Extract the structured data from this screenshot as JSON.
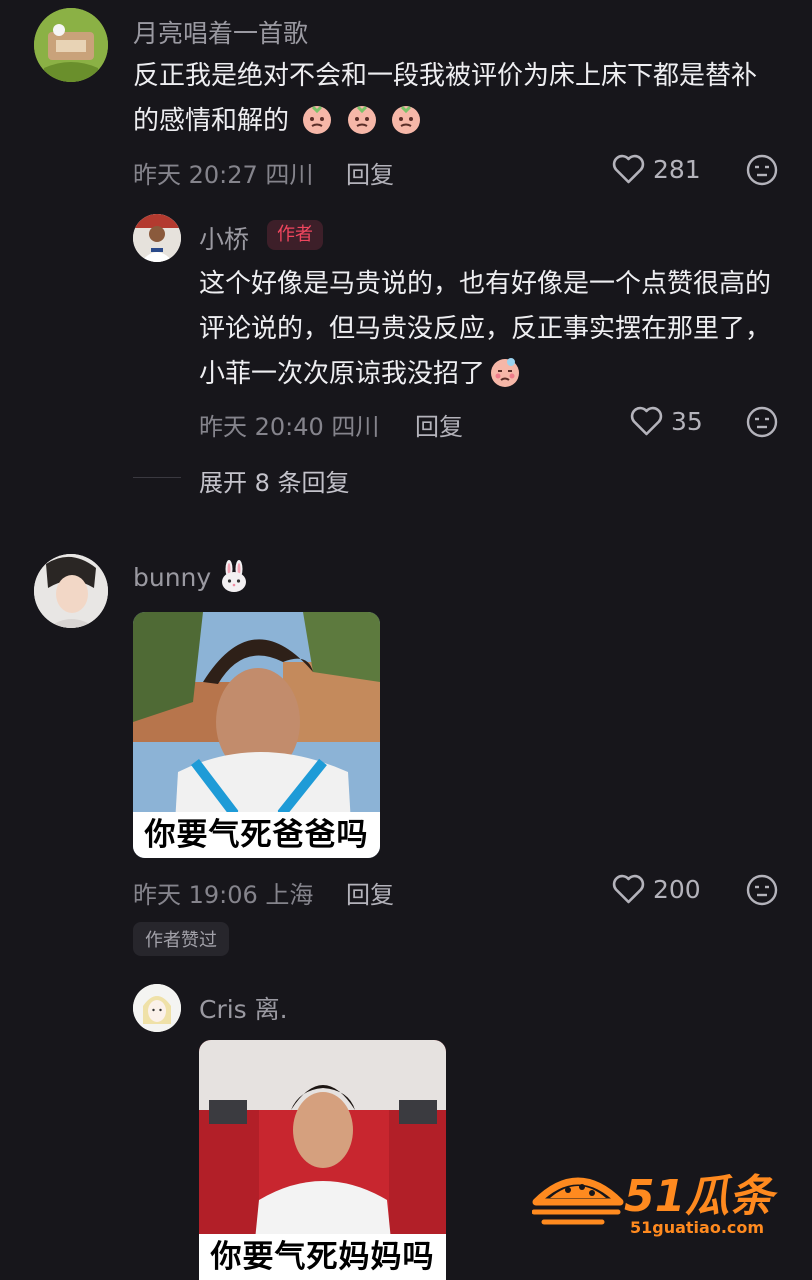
{
  "comments": [
    {
      "username": "月亮唱着一首歌",
      "text": "反正我是绝对不会和一段我被评价为床上床下都是替补的感情和解的",
      "time": "昨天 20:27 四川",
      "reply_label": "回复",
      "likes": "281",
      "emoji": "crying-face-emoji ×3"
    },
    {
      "username": "bunny",
      "username_emoji": "rabbit-emoji",
      "meme_caption": "你要气死爸爸吗",
      "time": "昨天 19:06 上海",
      "reply_label": "回复",
      "likes": "200",
      "author_liked": "作者赞过"
    }
  ],
  "reply": {
    "username": "小桥",
    "author_tag": "作者",
    "text": "这个好像是马贵说的，也有好像是一个点赞很高的评论说的，但马贵没反应，反正事实摆在那里了，小菲一次次原谅我没招了",
    "time": "昨天 20:40 四川",
    "reply_label": "回复",
    "likes": "35",
    "expand_label": "展开 8 条回复"
  },
  "reply2": {
    "username": "Cris 离.",
    "meme_caption": "你要气死妈妈吗"
  },
  "watermark": {
    "brand": "51瓜条",
    "domain": "51guatiao.com"
  },
  "colors": {
    "background": "#17161b",
    "author_tag": "#f0465e",
    "watermark": "#ff8a1f"
  }
}
